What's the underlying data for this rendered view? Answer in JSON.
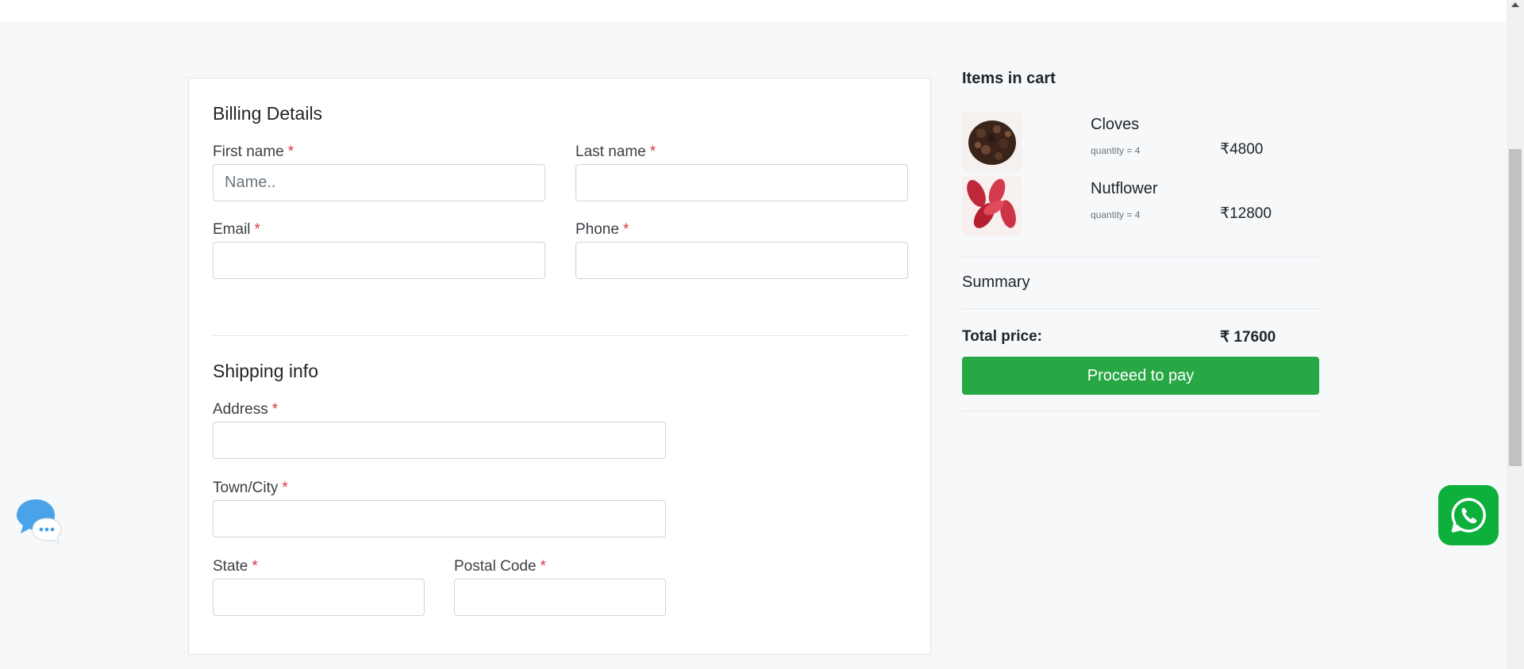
{
  "billing": {
    "title": "Billing Details",
    "first_name": {
      "label": "First name",
      "placeholder": "Name..",
      "value": ""
    },
    "last_name": {
      "label": "Last name",
      "value": ""
    },
    "email": {
      "label": "Email",
      "value": ""
    },
    "phone": {
      "label": "Phone",
      "value": ""
    }
  },
  "shipping": {
    "title": "Shipping info",
    "address": {
      "label": "Address",
      "value": ""
    },
    "city": {
      "label": "Town/City",
      "value": ""
    },
    "state": {
      "label": "State",
      "value": ""
    },
    "postal": {
      "label": "Postal Code",
      "value": ""
    }
  },
  "required_mark": "*",
  "cart": {
    "title": "Items in cart",
    "items": [
      {
        "name": "Cloves",
        "quantity": "quantity = 4",
        "price": "₹4800",
        "image_icon": "cloves-image"
      },
      {
        "name": "Nutflower",
        "quantity": "quantity = 4",
        "price": "₹12800",
        "image_icon": "nutflower-image"
      }
    ],
    "summary_label": "Summary",
    "total_label": "Total price:",
    "total_value": "₹ 17600",
    "pay_label": "Proceed to pay"
  },
  "colors": {
    "accent_green": "#28a745",
    "whatsapp_green": "#0db03b",
    "required_red": "#dc3545",
    "chat_blue": "#4aa3e8"
  },
  "icons": {
    "chat": "chat-bubble-icon",
    "whatsapp": "whatsapp-icon",
    "scroll_up": "scroll-up-arrow-icon"
  }
}
